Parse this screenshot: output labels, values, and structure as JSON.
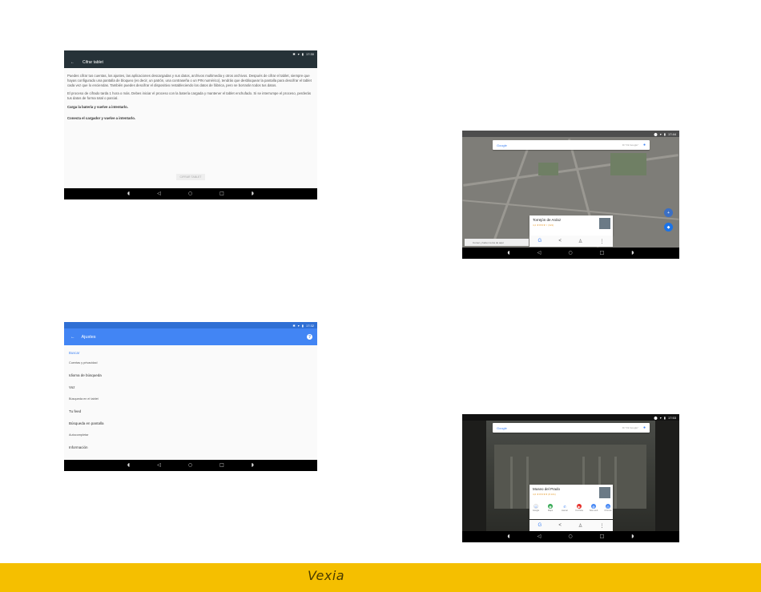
{
  "cifrar_screen": {
    "status_time": "17:30",
    "title": "Cifrar tablet",
    "para1": "Puedes cifrar tus cuentas, los ajustes, las aplicaciones descargadas y sus datos, archivos multimedia y otros archivos. Después de cifrar el tablet, siempre que hayas configurado una pantalla de bloqueo (es decir, un patrón, una contraseña o un PIN numérico), tendrás que desbloquear la pantalla para descifrar el tablet cada vez que lo enciendas. También puedes descifrar el dispositivo restableciendo los datos de fábrica, pero se borrarán todos tus datos.",
    "para2": "El proceso de cifrado tarda 1 hora o más. Debes iniciar el proceso con la batería cargada y mantener el tablet enchufado. Si se interrumpe el proceso, perderás tus datos de forma total o parcial.",
    "warning1": "Carga la batería y vuelve a intentarlo.",
    "warning2": "Conecta el cargador y vuelve a intentarlo.",
    "button": "CIFRAR TABLET"
  },
  "ajustes_screen": {
    "status_time": "17:32",
    "title": "Ajustes",
    "section": "Buscar",
    "items": [
      {
        "label": "Cuentas y privacidad"
      },
      {
        "label": "Idioma de búsqueda"
      },
      {
        "label": "Voz"
      },
      {
        "label": "Búsqueda en el tablet"
      },
      {
        "label": "Tu feed"
      },
      {
        "label": "Búsqueda en pantalla"
      },
      {
        "label": "Autocompletar"
      },
      {
        "label": "Información"
      }
    ]
  },
  "maps_screen": {
    "status_time": "17:44",
    "google": "Google",
    "hint": "Di \"Ok Google\"",
    "map_search": "Comer y beber cerca de aquí",
    "place": "Torrejón de Ardoz",
    "rating": "4,2 ★★★★☆ (321)"
  },
  "prado_screen": {
    "status_time": "17:53",
    "google": "Google",
    "hint": "Di \"Ok Google\"",
    "place": "Museo del Prado",
    "rating": "4,6 ★★★★★ (8.161)",
    "apps": [
      {
        "label": "Google",
        "color": "#ffffff",
        "glyph": "G"
      },
      {
        "label": "Maps",
        "color": "#34a853",
        "glyph": "◉"
      },
      {
        "label": "Llamar",
        "color": "#4285f4",
        "glyph": "✆"
      },
      {
        "label": "YouTube",
        "color": "#e52d27",
        "glyph": "▶"
      },
      {
        "label": "Sitio web",
        "color": "#4285f4",
        "glyph": "◍"
      },
      {
        "label": "Chrome",
        "color": "#4285f4",
        "glyph": "◎"
      }
    ]
  },
  "tools": {
    "google_glyph": "G",
    "share_glyph": "<",
    "person_glyph": "♙",
    "more_glyph": "⋮"
  },
  "footer": {
    "brand": "Vexia",
    "color": "#f5bf00"
  }
}
